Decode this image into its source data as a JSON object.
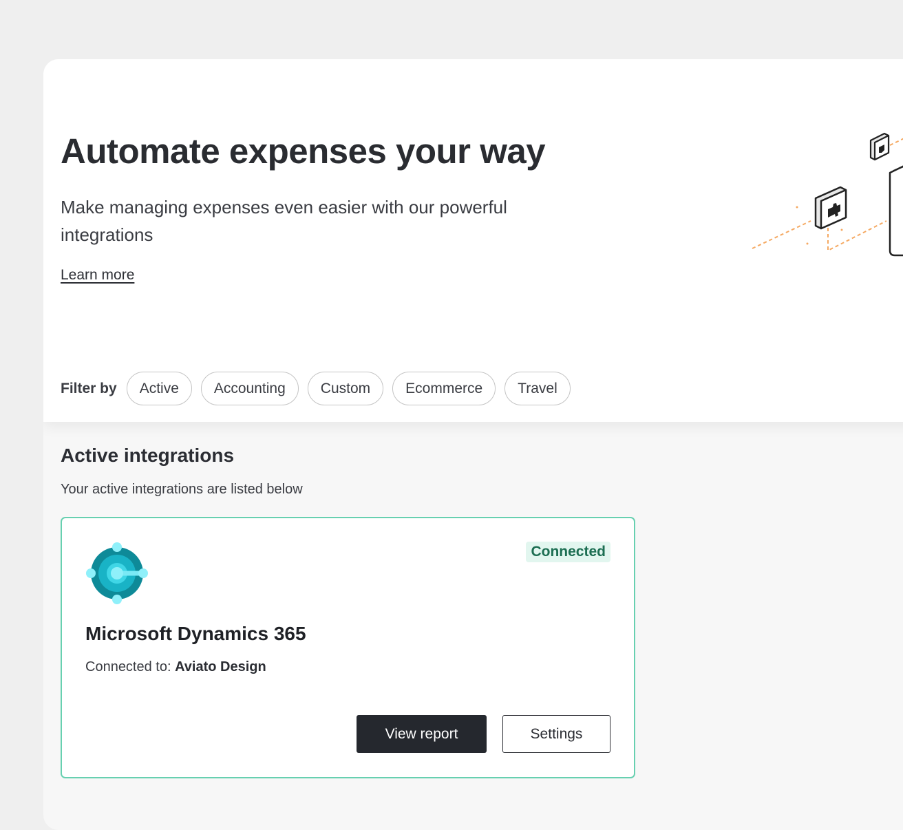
{
  "hero": {
    "title": "Automate expenses your way",
    "subtitle": "Make managing expenses even easier with our powerful integrations",
    "learn_more": "Learn more",
    "illustration_icon": "puzzle-plug-illustration"
  },
  "filters": {
    "label": "Filter by",
    "chips": [
      "Active",
      "Accounting",
      "Custom",
      "Ecommerce",
      "Travel"
    ]
  },
  "active_section": {
    "title": "Active integrations",
    "subtitle": "Your active integrations are listed below"
  },
  "integration_card": {
    "logo_icon": "dynamics-365-logo-icon",
    "status": "Connected",
    "name": "Microsoft Dynamics 365",
    "connected_to_label": "Connected to:",
    "connected_to_value": "Aviato Design",
    "primary_action": "View report",
    "secondary_action": "Settings"
  },
  "colors": {
    "accent_border": "#67d0b0",
    "status_bg": "#e2f6ef",
    "status_text": "#1c6e52",
    "primary_button": "#25282e",
    "illustration_accent": "#f5a962"
  }
}
